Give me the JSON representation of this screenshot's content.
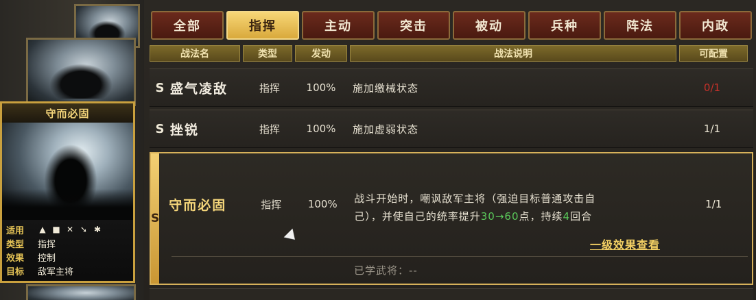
{
  "card": {
    "title": "守而必固",
    "rows": [
      {
        "key": "适用",
        "value": ""
      },
      {
        "key": "类型",
        "value": "指挥"
      },
      {
        "key": "效果",
        "value": "控制"
      },
      {
        "key": "目标",
        "value": "敌军主将"
      }
    ],
    "troop_icons": [
      "cavalry-icon",
      "shield-icon",
      "bow-icon",
      "spear-icon",
      "wheel-icon"
    ]
  },
  "tabs": [
    {
      "label": "全部",
      "active": false
    },
    {
      "label": "指挥",
      "active": true
    },
    {
      "label": "主动",
      "active": false
    },
    {
      "label": "突击",
      "active": false
    },
    {
      "label": "被动",
      "active": false
    },
    {
      "label": "兵种",
      "active": false
    },
    {
      "label": "阵法",
      "active": false
    },
    {
      "label": "内政",
      "active": false
    }
  ],
  "headers": {
    "name": "战法名",
    "type": "类型",
    "rate": "发动",
    "desc": "战法说明",
    "avail": "可配置"
  },
  "rows": [
    {
      "grade": "S",
      "name": "盛气凌敌",
      "type": "指挥",
      "rate": "100%",
      "desc": "施加缴械状态",
      "avail": "0/1"
    },
    {
      "grade": "S",
      "name": "挫锐",
      "type": "指挥",
      "rate": "100%",
      "desc": "施加虚弱状态",
      "avail": "1/1"
    }
  ],
  "selected": {
    "grade": "S",
    "name": "守而必固",
    "type": "指挥",
    "rate": "100%",
    "desc_line1": "战斗开始时，嘲讽敌军主将（强迫目标普通攻击自",
    "desc_line2_a": "己），并使自己的统率提升",
    "desc_line2_b": "30→60",
    "desc_line2_c": "点，持续",
    "desc_line2_d": "4",
    "desc_line2_e": "回合",
    "avail": "1/1",
    "link": "一级效果查看",
    "learned": "已学武将：--"
  },
  "colors": {
    "accent_gold": "#f2cf63",
    "tab_red": "#6b2a1c",
    "highlight_green": "#5ac85a",
    "unavailable_red": "#c7312a"
  }
}
